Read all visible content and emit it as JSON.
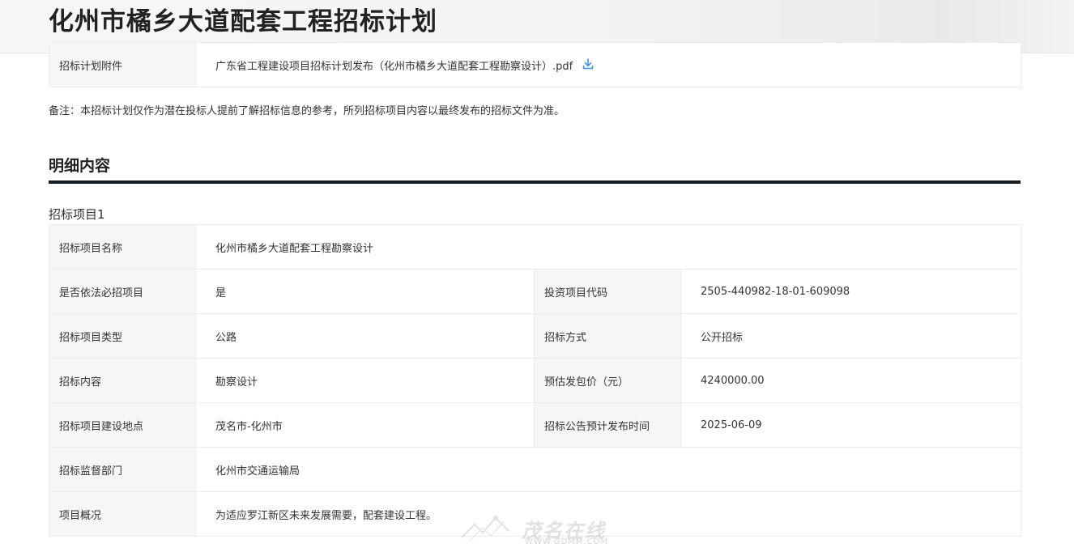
{
  "page": {
    "title": "化州市橘乡大道配套工程招标计划"
  },
  "attachment": {
    "label": "招标计划附件",
    "file_name": "广东省工程建设项目招标计划发布（化州市橘乡大道配套工程勘察设计）.pdf",
    "icon": "download-icon"
  },
  "note": "备注：本招标计划仅作为潜在投标人提前了解招标信息的参考，所列招标项目内容以最终发布的招标文件为准。",
  "detail": {
    "section_title": "明细内容",
    "project_heading": "招标项目1",
    "rows": {
      "name_label": "招标项目名称",
      "name_value": "化州市橘乡大道配套工程勘察设计",
      "mandatory_label": "是否依法必招项目",
      "mandatory_value": "是",
      "invest_code_label": "投资项目代码",
      "invest_code_value": "2505-440982-18-01-609098",
      "type_label": "招标项目类型",
      "type_value": "公路",
      "method_label": "招标方式",
      "method_value": "公开招标",
      "content_label": "招标内容",
      "content_value": "勘察设计",
      "price_label": "预估发包价（元）",
      "price_value": "4240000.00",
      "location_label": "招标项目建设地点",
      "location_value": "茂名市-化州市",
      "publish_label": "招标公告预计发布时间",
      "publish_value": "2025-06-09",
      "dept_label": "招标监督部门",
      "dept_value": "化州市交通运输局",
      "overview_label": "项目概况",
      "overview_value": "为适应罗江新区未来发展需要，配套建设工程。"
    }
  },
  "watermark": {
    "name": "茂名在线",
    "url": "WWW.GDMM.COM"
  },
  "colors": {
    "label_bg": "#f6f6f6",
    "border": "#ececec",
    "rule": "#141c26",
    "link_icon": "#3a8ee6"
  }
}
